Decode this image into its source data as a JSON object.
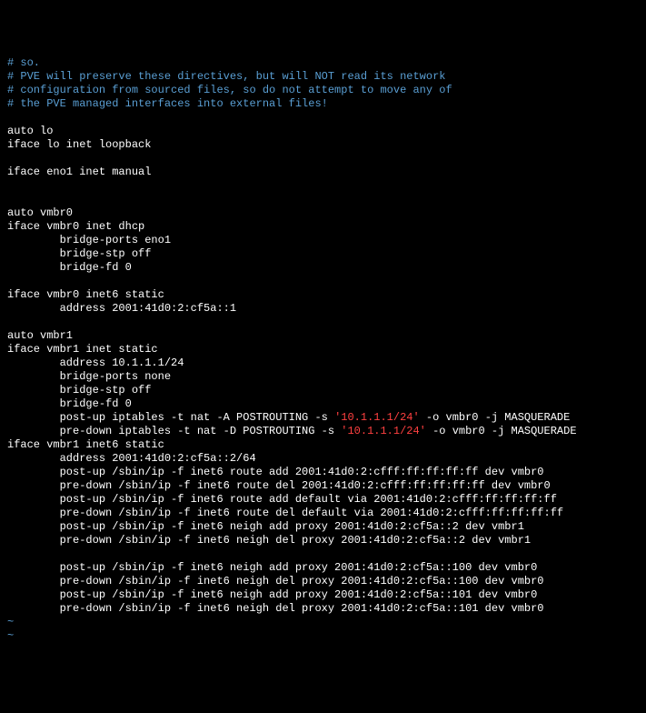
{
  "lines": [
    {
      "cls": "comment",
      "t": "# so."
    },
    {
      "cls": "comment",
      "t": "# PVE will preserve these directives, but will NOT read its network"
    },
    {
      "cls": "comment",
      "t": "# configuration from sourced files, so do not attempt to move any of"
    },
    {
      "cls": "comment",
      "t": "# the PVE managed interfaces into external files!"
    },
    {
      "cls": "",
      "t": ""
    },
    {
      "cls": "",
      "t": "auto lo"
    },
    {
      "cls": "",
      "t": "iface lo inet loopback"
    },
    {
      "cls": "",
      "t": ""
    },
    {
      "cls": "",
      "t": "iface eno1 inet manual"
    },
    {
      "cls": "",
      "t": ""
    },
    {
      "cls": "",
      "t": ""
    },
    {
      "cls": "",
      "t": "auto vmbr0"
    },
    {
      "cls": "",
      "t": "iface vmbr0 inet dhcp"
    },
    {
      "cls": "",
      "t": "        bridge-ports eno1"
    },
    {
      "cls": "",
      "t": "        bridge-stp off"
    },
    {
      "cls": "",
      "t": "        bridge-fd 0"
    },
    {
      "cls": "",
      "t": ""
    },
    {
      "cls": "",
      "t": "iface vmbr0 inet6 static"
    },
    {
      "cls": "",
      "t": "        address 2001:41d0:2:cf5a::1"
    },
    {
      "cls": "",
      "t": ""
    },
    {
      "cls": "",
      "t": "auto vmbr1"
    },
    {
      "cls": "",
      "t": "iface vmbr1 inet static"
    },
    {
      "cls": "",
      "t": "        address 10.1.1.1/24"
    },
    {
      "cls": "",
      "t": "        bridge-ports none"
    },
    {
      "cls": "",
      "t": "        bridge-stp off"
    },
    {
      "cls": "",
      "t": "        bridge-fd 0"
    },
    {
      "segs": [
        {
          "cls": "",
          "t": "        post-up iptables -t nat -A POSTROUTING -s "
        },
        {
          "cls": "string",
          "t": "'10.1.1.1/24'"
        },
        {
          "cls": "",
          "t": " -o vmbr0 -j MASQUERADE"
        }
      ]
    },
    {
      "segs": [
        {
          "cls": "",
          "t": "        pre-down iptables -t nat -D POSTROUTING -s "
        },
        {
          "cls": "string",
          "t": "'10.1.1.1/24'"
        },
        {
          "cls": "",
          "t": " -o vmbr0 -j MASQUERADE"
        }
      ]
    },
    {
      "cls": "",
      "t": "iface vmbr1 inet6 static"
    },
    {
      "cls": "",
      "t": "        address 2001:41d0:2:cf5a::2/64"
    },
    {
      "cls": "",
      "t": "        post-up /sbin/ip -f inet6 route add 2001:41d0:2:cfff:ff:ff:ff:ff dev vmbr0"
    },
    {
      "cls": "",
      "t": "        pre-down /sbin/ip -f inet6 route del 2001:41d0:2:cfff:ff:ff:ff:ff dev vmbr0"
    },
    {
      "cls": "",
      "t": "        post-up /sbin/ip -f inet6 route add default via 2001:41d0:2:cfff:ff:ff:ff:ff"
    },
    {
      "cls": "",
      "t": "        pre-down /sbin/ip -f inet6 route del default via 2001:41d0:2:cfff:ff:ff:ff:ff"
    },
    {
      "cls": "",
      "t": "        post-up /sbin/ip -f inet6 neigh add proxy 2001:41d0:2:cf5a::2 dev vmbr1"
    },
    {
      "cls": "",
      "t": "        pre-down /sbin/ip -f inet6 neigh del proxy 2001:41d0:2:cf5a::2 dev vmbr1"
    },
    {
      "cls": "",
      "t": ""
    },
    {
      "cls": "",
      "t": "        post-up /sbin/ip -f inet6 neigh add proxy 2001:41d0:2:cf5a::100 dev vmbr0"
    },
    {
      "cls": "",
      "t": "        pre-down /sbin/ip -f inet6 neigh del proxy 2001:41d0:2:cf5a::100 dev vmbr0"
    },
    {
      "cls": "",
      "t": "        post-up /sbin/ip -f inet6 neigh add proxy 2001:41d0:2:cf5a::101 dev vmbr0"
    },
    {
      "cls": "",
      "t": "        pre-down /sbin/ip -f inet6 neigh del proxy 2001:41d0:2:cf5a::101 dev vmbr0"
    },
    {
      "cls": "tilde",
      "t": "~"
    },
    {
      "cls": "tilde",
      "t": "~"
    }
  ]
}
